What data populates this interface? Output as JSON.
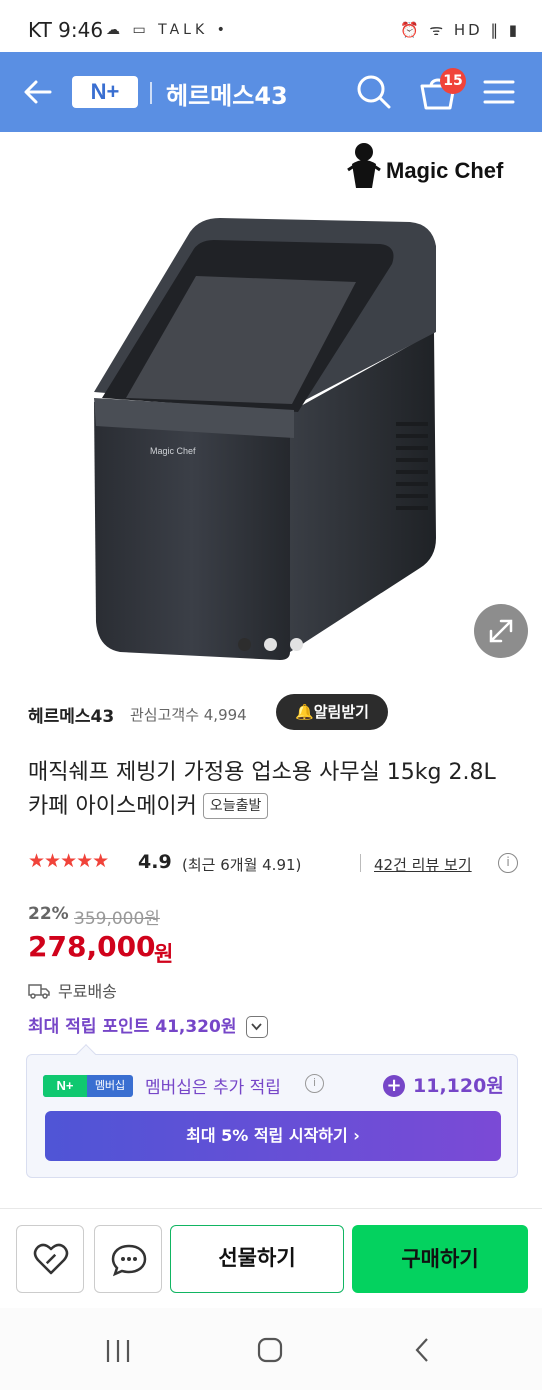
{
  "status_bar": {
    "carrier_time": "KT 9:46",
    "left_icons": "☁ ▭ TALK •",
    "right_icons": "⏰ ᯤ HD ‖ ▮"
  },
  "header": {
    "logo": "N+",
    "title": "헤르메스43",
    "cart_count": "15",
    "color": "#5a8fe3"
  },
  "hero": {
    "brand_logo": "Magic Chef",
    "product_brand_print": "Magic Chef",
    "slide_count": 3,
    "active_slide": 1
  },
  "seller": {
    "name": "헤르메스43",
    "interest_label": "관심고객수 4,994",
    "alarm_button": "알림받기"
  },
  "product": {
    "title": "매직쉐프 제빙기 가정용 업소용 사무실 15kg 2.8L 카페 아이스메이커",
    "tag": "오늘출발"
  },
  "rating": {
    "stars": "★★★★★",
    "score": "4.9",
    "recent": "(최근 6개월 4.91)",
    "review_link": "42건 리뷰 보기",
    "info": "i"
  },
  "price": {
    "discount": "22%",
    "original": "359,000원",
    "sale": "278,000",
    "currency": "원"
  },
  "shipping": {
    "label": "무료배송"
  },
  "points": {
    "label": "최대 적립 포인트 41,320원"
  },
  "membership": {
    "badge_logo": "N+",
    "badge_label": "멤버십",
    "text": "멤버십은 추가 적립",
    "info": "i",
    "plus": "+",
    "bonus": "11,120원",
    "cta": "최대 5% 적립 시작하기 ›"
  },
  "actions": {
    "gift": "선물하기",
    "buy": "구매하기",
    "accent": "#04d25f"
  }
}
